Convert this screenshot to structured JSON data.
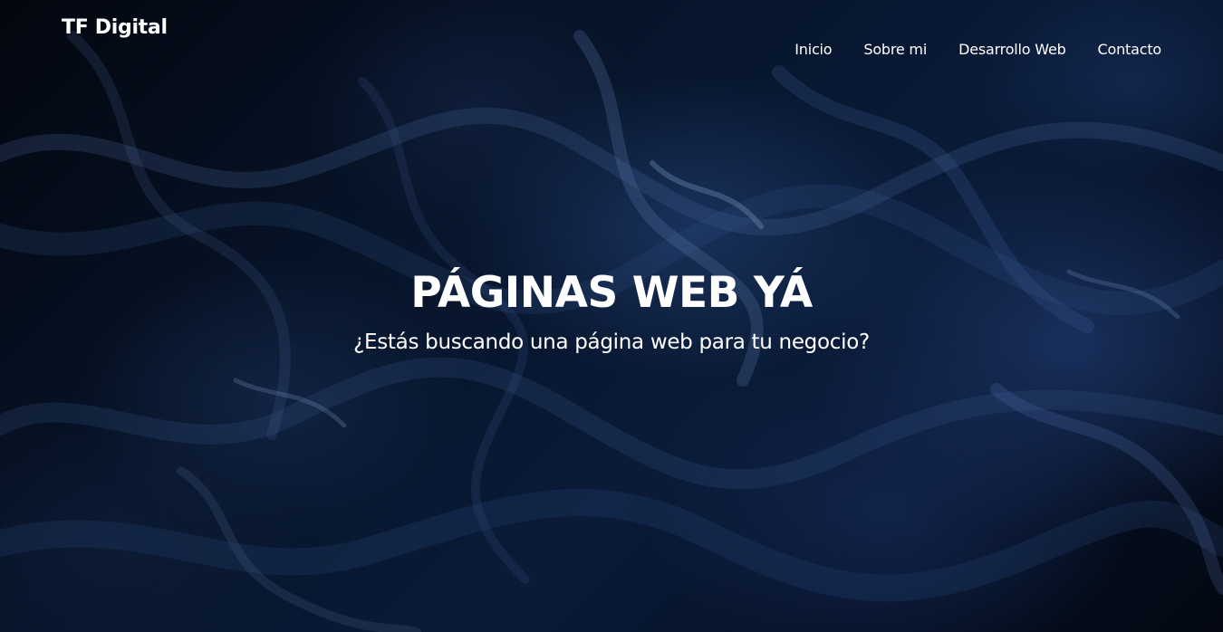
{
  "brand": {
    "name": "TF Digital"
  },
  "nav": {
    "items": [
      {
        "label": "Inicio"
      },
      {
        "label": "Sobre mi"
      },
      {
        "label": "Desarrollo Web"
      },
      {
        "label": "Contacto"
      }
    ]
  },
  "hero": {
    "title": "PÁGINAS WEB YÁ",
    "subtitle": "¿Estás buscando una página web para tu negocio?",
    "background": "dark blue marbled fluid-art texture"
  },
  "colors": {
    "text": "#ffffff",
    "background_dark": "#03070f",
    "background_blue": "#0a1b38",
    "accent_blue": "#1c3464"
  }
}
